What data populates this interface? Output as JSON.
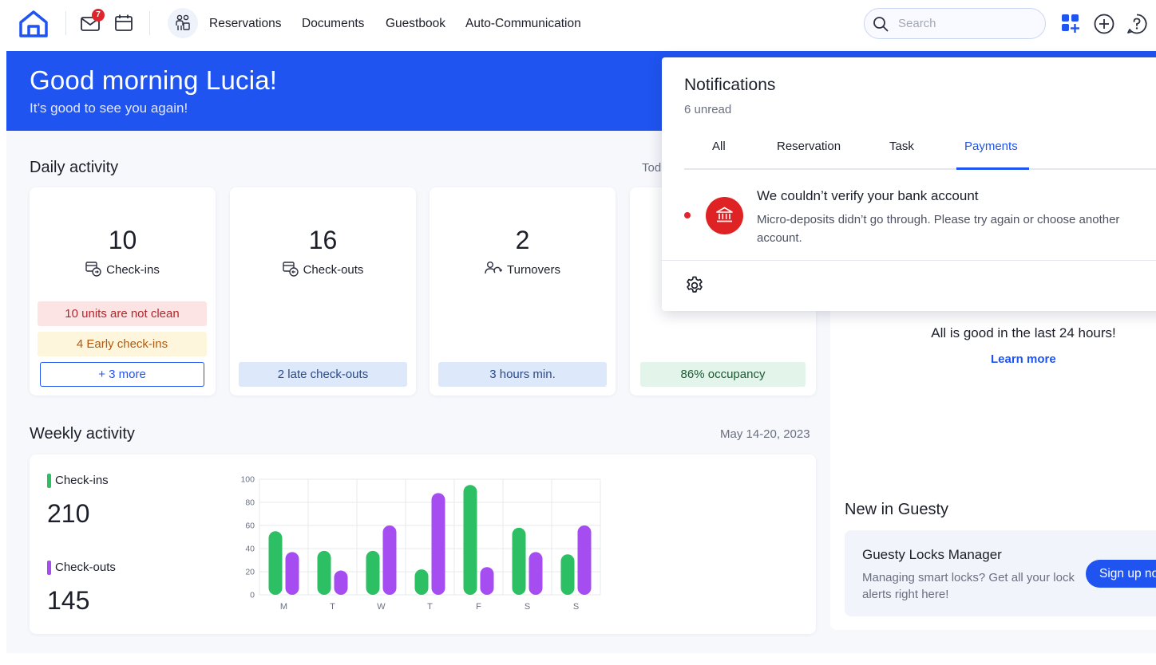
{
  "topbar": {
    "mail_badge": "7",
    "nav": [
      "Reservations",
      "Documents",
      "Guestbook",
      "Auto-Communication"
    ],
    "search_placeholder": "Search"
  },
  "hero": {
    "title": "Good morning Lucia!",
    "subtitle": "It’s good to see you again!"
  },
  "daily": {
    "title": "Daily activity",
    "date_label_partial": "Tod",
    "cards": [
      {
        "value": "10",
        "label": "Check-ins",
        "pills": [
          "10 units are not clean",
          "4 Early check-ins",
          "+ 3 more"
        ]
      },
      {
        "value": "16",
        "label": "Check-outs",
        "pills": [
          "2 late check-outs"
        ]
      },
      {
        "value": "2",
        "label": "Turnovers",
        "pills": [
          "3 hours min."
        ]
      },
      {
        "pills": [
          "86% occupancy"
        ]
      }
    ]
  },
  "weekly": {
    "title": "Weekly activity",
    "date": "May 14-20, 2023",
    "checkins_label": "Check-ins",
    "checkins_total": "210",
    "checkouts_label": "Check-outs",
    "checkouts_total": "145"
  },
  "colors": {
    "accent": "#1f54f0",
    "checkins": "#2cbf63",
    "checkouts": "#a64df2",
    "alert": "#df2324"
  },
  "chart_data": {
    "type": "bar",
    "categories": [
      "M",
      "T",
      "W",
      "T",
      "F",
      "S",
      "S"
    ],
    "series": [
      {
        "name": "Check-ins",
        "values": [
          55,
          38,
          38,
          22,
          95,
          58,
          35
        ]
      },
      {
        "name": "Check-outs",
        "values": [
          37,
          21,
          60,
          88,
          24,
          37,
          60
        ]
      }
    ],
    "yticks": [
      0,
      20,
      40,
      60,
      80,
      100
    ],
    "ylim": [
      0,
      100
    ],
    "grid": true
  },
  "right": {
    "status": "All is good in the last 24 hours!",
    "learn_more": "Learn more",
    "new_title": "New in Guesty",
    "promo_title": "Guesty Locks Manager",
    "promo_desc": "Managing smart locks? Get all your lock alerts right here!",
    "signup": "Sign up now"
  },
  "notifications": {
    "title": "Notifications",
    "unread": "6 unread",
    "tabs": [
      "All",
      "Reservation",
      "Task",
      "Payments"
    ],
    "active_tab": "Payments",
    "item_title": "We couldn’t verify your bank account",
    "item_body": "Micro-deposits didn’t go through. Please try again or choose another account."
  }
}
